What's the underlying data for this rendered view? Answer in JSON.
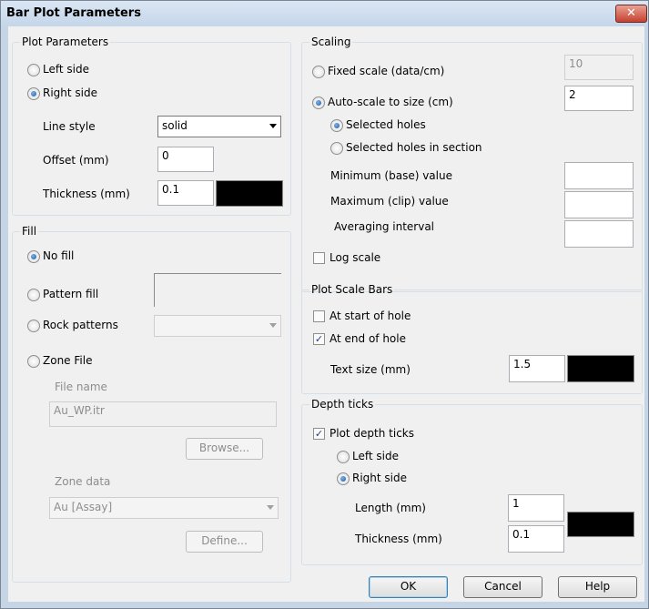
{
  "window": {
    "title": "Bar Plot Parameters",
    "close_symbol": "✕"
  },
  "plot_parameters": {
    "legend": "Plot Parameters",
    "left_side": "Left side",
    "right_side": "Right side",
    "line_style_label": "Line style",
    "line_style_value": "solid",
    "offset_label": "Offset (mm)",
    "offset_value": "0",
    "thickness_label": "Thickness (mm)",
    "thickness_value": "0.1"
  },
  "fill": {
    "legend": "Fill",
    "no_fill": "No fill",
    "pattern_fill": "Pattern fill",
    "rock_patterns": "Rock patterns",
    "zone_file": "Zone File",
    "file_name_label": "File name",
    "file_name_value": "Au_WP.itr",
    "browse": "Browse...",
    "zone_data_label": "Zone data",
    "zone_data_value": "Au [Assay]",
    "define": "Define..."
  },
  "scaling": {
    "legend": "Scaling",
    "fixed_scale": "Fixed scale (data/cm)",
    "fixed_scale_value": "10",
    "auto_scale": "Auto-scale to size (cm)",
    "auto_scale_value": "2",
    "selected_holes": "Selected holes",
    "selected_holes_section": "Selected holes in section",
    "min_label": "Minimum (base) value",
    "max_label": "Maximum (clip) value",
    "avg_label": "Averaging interval",
    "log_scale": "Log scale"
  },
  "scale_bars": {
    "legend": "Plot Scale Bars",
    "start": "At start of hole",
    "end": "At end of hole",
    "text_size_label": "Text size (mm)",
    "text_size_value": "1.5"
  },
  "depth_ticks": {
    "legend": "Depth ticks",
    "plot": "Plot depth ticks",
    "left_side": "Left side",
    "right_side": "Right side",
    "length_label": "Length (mm)",
    "length_value": "1",
    "thickness_label": "Thickness (mm)",
    "thickness_value": "0.1"
  },
  "buttons": {
    "ok": "OK",
    "cancel": "Cancel",
    "help": "Help"
  },
  "colors": {
    "line_color": "#000000",
    "scale_bar_color": "#000000",
    "tick_color": "#000000"
  },
  "check_symbol": "✓"
}
